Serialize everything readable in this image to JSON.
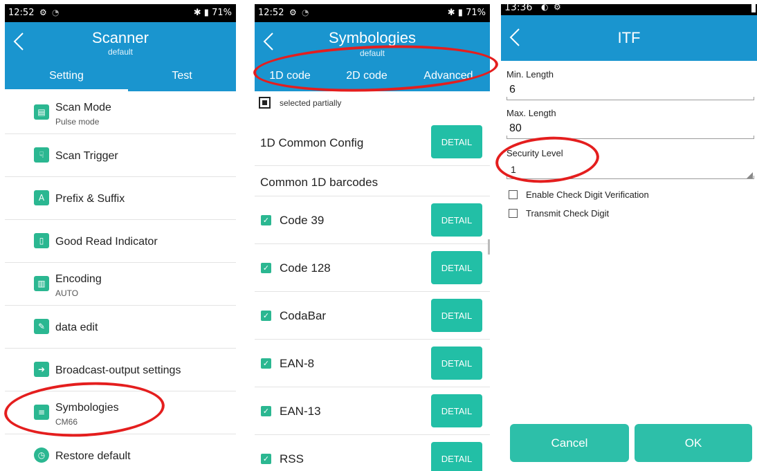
{
  "screens": [
    {
      "status": {
        "time": "12:52",
        "battery": "71%"
      },
      "header": {
        "title": "Scanner",
        "subtitle": "default"
      },
      "tabs": [
        "Setting",
        "Test"
      ],
      "items": [
        {
          "title": "Scan Mode",
          "sub": "Pulse mode",
          "icon": "barcode-scan-icon"
        },
        {
          "title": "Scan Trigger",
          "sub": "",
          "icon": "trigger-icon"
        },
        {
          "title": "Prefix & Suffix",
          "sub": "",
          "icon": "text-format-icon"
        },
        {
          "title": "Good Read Indicator",
          "sub": "",
          "icon": "phone-notification-icon"
        },
        {
          "title": "Encoding",
          "sub": "AUTO",
          "icon": "barcode-icon"
        },
        {
          "title": "data edit",
          "sub": "",
          "icon": "edit-icon"
        },
        {
          "title": "Broadcast-output settings",
          "sub": "",
          "icon": "export-icon"
        },
        {
          "title": "Symbologies",
          "sub": "CM66",
          "icon": "sliders-icon"
        },
        {
          "title": "Restore default",
          "sub": "",
          "icon": "clock-icon"
        }
      ]
    },
    {
      "status": {
        "time": "12:52",
        "battery": "71%"
      },
      "header": {
        "title": "Symbologies",
        "subtitle": "default"
      },
      "tabs": [
        "1D code",
        "2D code",
        "Advanced"
      ],
      "legend": "selected partially",
      "common_config": "1D Common Config",
      "section_title": "Common 1D barcodes",
      "detail_label": "DETAIL",
      "barcodes": [
        "Code 39",
        "Code 128",
        "CodaBar",
        "EAN-8",
        "EAN-13",
        "RSS"
      ]
    },
    {
      "status": {
        "time": "13:36"
      },
      "header": {
        "title": "ITF"
      },
      "fields": [
        {
          "label": "Min. Length",
          "value": "6"
        },
        {
          "label": "Max. Length",
          "value": "80"
        }
      ],
      "security": {
        "label": "Security Level",
        "value": "1"
      },
      "checkboxes": [
        "Enable Check Digit Verification",
        "Transmit Check Digit"
      ],
      "buttons": {
        "cancel": "Cancel",
        "ok": "OK"
      }
    }
  ],
  "colors": {
    "app_bar": "#1a95cf",
    "accent_green": "#2bb791",
    "annotation_red": "#e41e1e"
  }
}
